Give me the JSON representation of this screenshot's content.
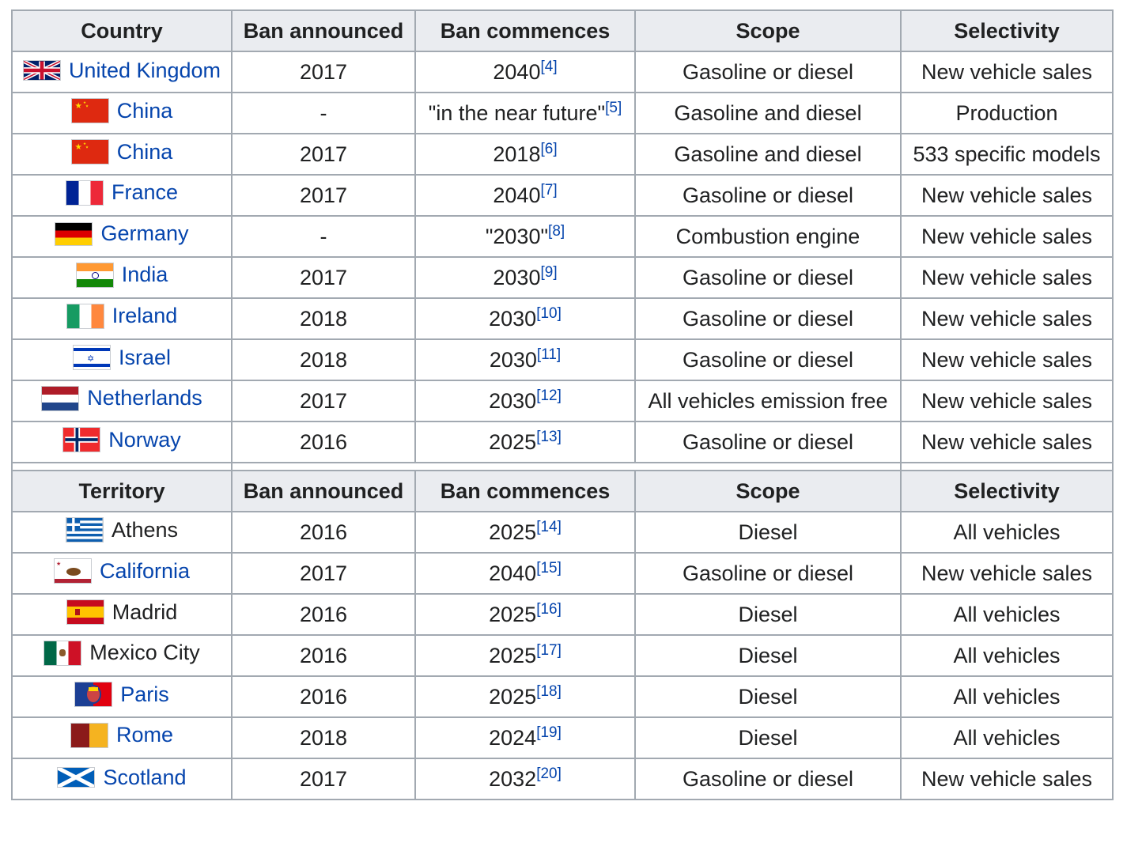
{
  "countries_header": [
    "Country",
    "Ban announced",
    "Ban commences",
    "Scope",
    "Selectivity"
  ],
  "countries": [
    {
      "name": "United Kingdom",
      "flag": "uk-flag-icon",
      "announced": "2017",
      "commences": "2040",
      "ref": "[4]",
      "scope": "Gasoline or diesel",
      "selectivity": "New vehicle sales",
      "linked": true
    },
    {
      "name": "China",
      "flag": "china-flag-icon",
      "announced": "-",
      "commences": "\"in the near future\"",
      "ref": "[5]",
      "scope": "Gasoline and diesel",
      "selectivity": "Production",
      "linked": true
    },
    {
      "name": "China",
      "flag": "china-flag-icon",
      "announced": "2017",
      "commences": "2018",
      "ref": "[6]",
      "scope": "Gasoline and diesel",
      "selectivity": "533 specific models",
      "linked": true
    },
    {
      "name": "France",
      "flag": "france-flag-icon",
      "announced": "2017",
      "commences": "2040",
      "ref": "[7]",
      "scope": "Gasoline or diesel",
      "selectivity": "New vehicle sales",
      "linked": true
    },
    {
      "name": "Germany",
      "flag": "germany-flag-icon",
      "announced": "-",
      "commences": "\"2030\"",
      "ref": "[8]",
      "scope": "Combustion engine",
      "selectivity": "New vehicle sales",
      "linked": true
    },
    {
      "name": "India",
      "flag": "india-flag-icon",
      "announced": "2017",
      "commences": "2030",
      "ref": "[9]",
      "scope": "Gasoline or diesel",
      "selectivity": "New vehicle sales",
      "linked": true
    },
    {
      "name": "Ireland",
      "flag": "ireland-flag-icon",
      "announced": "2018",
      "commences": "2030",
      "ref": "[10]",
      "scope": "Gasoline or diesel",
      "selectivity": "New vehicle sales",
      "linked": true
    },
    {
      "name": "Israel",
      "flag": "israel-flag-icon",
      "announced": "2018",
      "commences": "2030",
      "ref": "[11]",
      "scope": "Gasoline or diesel",
      "selectivity": "New vehicle sales",
      "linked": true
    },
    {
      "name": "Netherlands",
      "flag": "netherlands-flag-icon",
      "announced": "2017",
      "commences": "2030",
      "ref": "[12]",
      "scope": "All vehicles emission free",
      "selectivity": "New vehicle sales",
      "linked": true
    },
    {
      "name": "Norway",
      "flag": "norway-flag-icon",
      "announced": "2016",
      "commences": "2025",
      "ref": "[13]",
      "scope": "Gasoline or diesel",
      "selectivity": "New vehicle sales",
      "linked": true
    }
  ],
  "territories_header": [
    "Territory",
    "Ban announced",
    "Ban commences",
    "Scope",
    "Selectivity"
  ],
  "territories": [
    {
      "name": "Athens",
      "flag": "greece-flag-icon",
      "announced": "2016",
      "commences": "2025",
      "ref": "[14]",
      "scope": "Diesel",
      "selectivity": "All vehicles",
      "linked": false
    },
    {
      "name": "California",
      "flag": "california-flag-icon",
      "announced": "2017",
      "commences": "2040",
      "ref": "[15]",
      "scope": "Gasoline or diesel",
      "selectivity": "New vehicle sales",
      "linked": true
    },
    {
      "name": "Madrid",
      "flag": "madrid-flag-icon",
      "announced": "2016",
      "commences": "2025",
      "ref": "[16]",
      "scope": "Diesel",
      "selectivity": "All vehicles",
      "linked": false
    },
    {
      "name": "Mexico City",
      "flag": "mexico-flag-icon",
      "announced": "2016",
      "commences": "2025",
      "ref": "[17]",
      "scope": "Diesel",
      "selectivity": "All vehicles",
      "linked": false
    },
    {
      "name": "Paris",
      "flag": "paris-flag-icon",
      "announced": "2016",
      "commences": "2025",
      "ref": "[18]",
      "scope": "Diesel",
      "selectivity": "All vehicles",
      "linked": true
    },
    {
      "name": "Rome",
      "flag": "rome-flag-icon",
      "announced": "2018",
      "commences": "2024",
      "ref": "[19]",
      "scope": "Diesel",
      "selectivity": "All vehicles",
      "linked": true
    },
    {
      "name": "Scotland",
      "flag": "scotland-flag-icon",
      "announced": "2017",
      "commences": "2032",
      "ref": "[20]",
      "scope": "Gasoline or diesel",
      "selectivity": "New vehicle sales",
      "linked": true
    }
  ]
}
